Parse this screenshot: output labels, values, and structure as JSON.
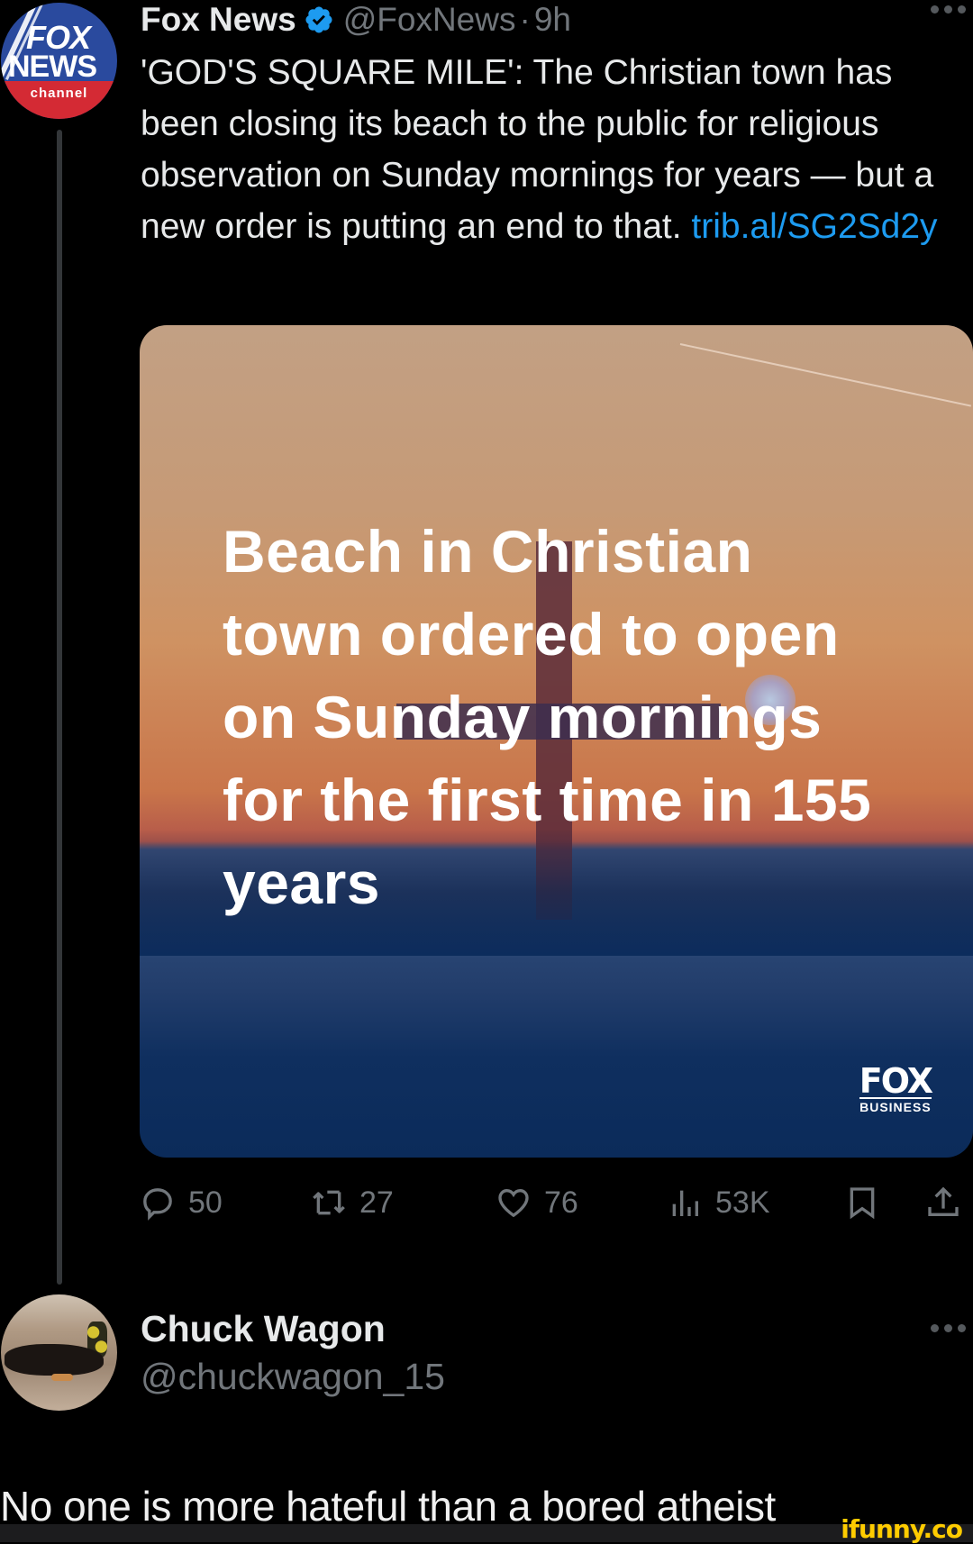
{
  "tweet": {
    "author": {
      "display_name": "Fox News",
      "verified": true,
      "handle": "@FoxNews",
      "separator": "·",
      "time": "9h",
      "avatar": {
        "line1": "FOX",
        "line2": "NEWS",
        "line3": "channel"
      }
    },
    "text": "'GOD'S SQUARE MILE': The Christian town has been closing its beach to the public for religious observation on Sunday mornings for years — but a new order is putting an end to that. ",
    "link": "trib.al/SG2Sd2y",
    "media": {
      "headline": "Beach in Christian town ordered to open on Sunday mornings for the first time in 155 years",
      "logo_top": "FOX",
      "logo_bottom": "BUSINESS"
    },
    "actions": {
      "replies": "50",
      "retweets": "27",
      "likes": "76",
      "views": "53K"
    },
    "more_icon": "more-horizontal-icon"
  },
  "reply": {
    "display_name": "Chuck Wagon",
    "handle": "@chuckwagon_15",
    "more_icon": "more-horizontal-icon"
  },
  "caption": "No one is more hateful than a bored atheist",
  "watermark": "ifunny.co",
  "colors": {
    "background": "#000000",
    "text_primary": "#e7e9ea",
    "text_secondary": "#71767b",
    "link": "#1d9bf0",
    "verified": "#1d9bf0",
    "thread_line": "#333639",
    "watermark": "#ffcc00"
  }
}
